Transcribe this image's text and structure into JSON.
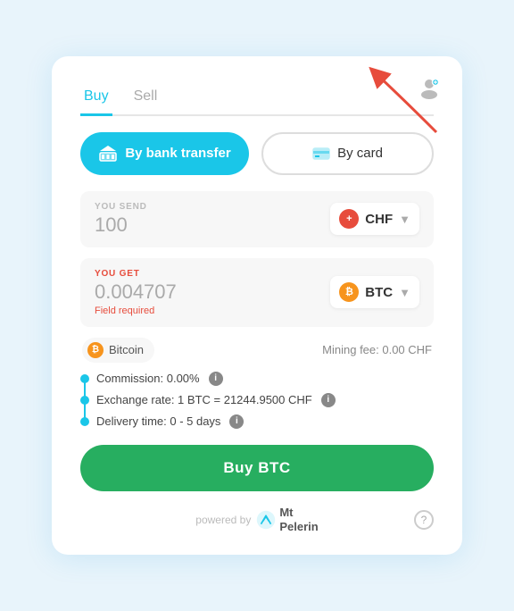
{
  "tabs": {
    "buy": "Buy",
    "sell": "Sell"
  },
  "payment": {
    "bank_label": "By bank transfer",
    "card_label": "By card"
  },
  "send": {
    "label": "YOU SEND",
    "value": "100",
    "currency": "CHF",
    "flag": "+"
  },
  "get": {
    "label": "YOU GET",
    "value": "0.004707",
    "currency": "BTC",
    "field_required": "Field required"
  },
  "info_row": {
    "coin_name": "Bitcoin",
    "mining_fee": "Mining fee: 0.00 CHF"
  },
  "details": {
    "commission": "Commission: 0.00%",
    "exchange_rate": "Exchange rate: 1 BTC = 21244.9500 CHF",
    "delivery": "Delivery time: 0 - 5 days"
  },
  "buy_button": "Buy BTC",
  "footer": {
    "powered_by": "powered by",
    "brand": "Mt\nPelerin"
  }
}
